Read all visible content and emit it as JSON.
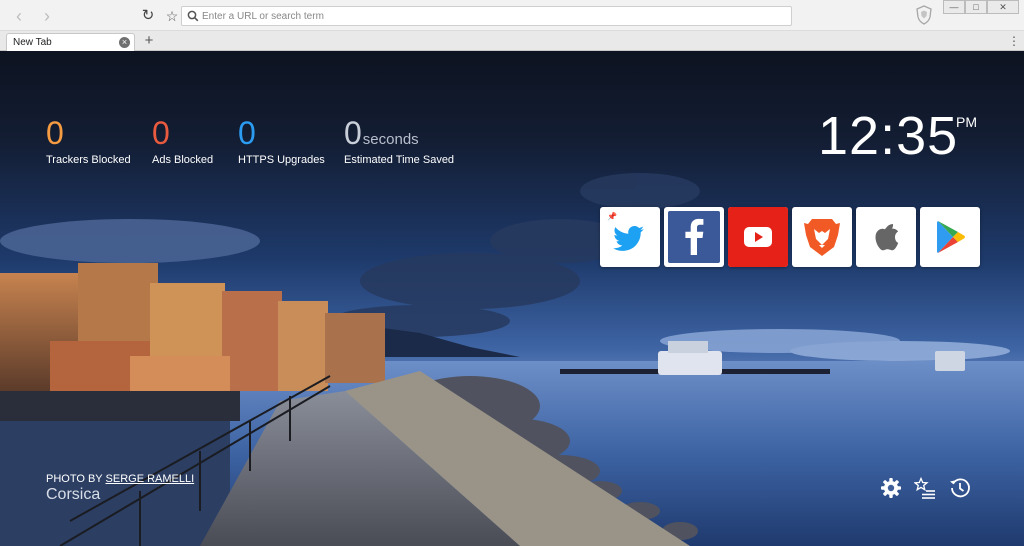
{
  "toolbar": {
    "back_glyph": "‹",
    "forward_glyph": "›",
    "reload_glyph": "↻",
    "bookmark_glyph": "☆",
    "url_placeholder": "Enter a URL or search term",
    "url_value": ""
  },
  "window_controls": {
    "minimize": "—",
    "restore": "□",
    "close": "✕"
  },
  "tabs": [
    {
      "title": "New Tab",
      "close_glyph": "×"
    }
  ],
  "new_tab_glyph": "+",
  "menu_glyph": "⋮",
  "stats": [
    {
      "value": "0",
      "unit": "",
      "label": "Trackers Blocked",
      "color": "#f59b42"
    },
    {
      "value": "0",
      "unit": "",
      "label": "Ads Blocked",
      "color": "#ea5a3f"
    },
    {
      "value": "0",
      "unit": "",
      "label": "HTTPS Upgrades",
      "color": "#2b9cf2"
    },
    {
      "value": "0",
      "unit": "seconds",
      "label": "Estimated Time Saved",
      "color": "#c9cfd9"
    }
  ],
  "clock": {
    "time": "12:35",
    "ampm": "PM"
  },
  "top_sites": [
    {
      "name": "twitter-icon",
      "pinned": true,
      "bg": "#ffffff",
      "color": "#1da1f2"
    },
    {
      "name": "facebook-icon",
      "pinned": false,
      "bg": "#3b5998",
      "color": "#ffffff"
    },
    {
      "name": "youtube-icon",
      "pinned": false,
      "bg": "#e62117",
      "color": "#ffffff"
    },
    {
      "name": "brave-icon",
      "pinned": false,
      "bg": "#ffffff",
      "color": "#f15a24"
    },
    {
      "name": "apple-icon",
      "pinned": false,
      "bg": "#ffffff",
      "color": "#555555"
    },
    {
      "name": "google-play-icon",
      "pinned": false,
      "bg": "#ffffff",
      "color": "#34a853"
    }
  ],
  "photo_credit": {
    "prefix": "PHOTO BY ",
    "author": "SERGE RAMELLI",
    "location": "Corsica"
  },
  "bottom_actions": [
    {
      "name": "settings-gear-icon"
    },
    {
      "name": "bookmarks-icon"
    },
    {
      "name": "history-icon"
    }
  ]
}
